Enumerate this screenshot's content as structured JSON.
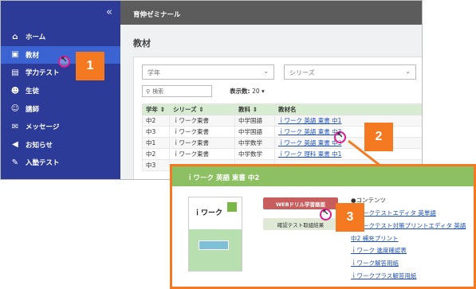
{
  "sidebar": {
    "collapse_glyph": "«",
    "items": [
      {
        "label": "ホーム",
        "icon": "home-icon",
        "glyph": "⌂",
        "active": false
      },
      {
        "label": "教材",
        "icon": "book-icon",
        "glyph": "▣",
        "active": true
      },
      {
        "label": "学力テスト",
        "icon": "test-icon",
        "glyph": "▤",
        "active": false
      },
      {
        "label": "生徒",
        "icon": "students-icon",
        "glyph": "☻",
        "active": false
      },
      {
        "label": "講師",
        "icon": "teachers-icon",
        "glyph": "☺",
        "active": false
      },
      {
        "label": "メッセージ",
        "icon": "message-icon",
        "glyph": "✉",
        "active": false
      },
      {
        "label": "お知らせ",
        "icon": "announce-icon",
        "glyph": "◀",
        "active": false
      },
      {
        "label": "入塾テスト",
        "icon": "entrance-test-icon",
        "glyph": "✎",
        "active": false
      }
    ]
  },
  "topbar": {
    "title": "育伸ゼミナール"
  },
  "main": {
    "title": "教材",
    "filters": {
      "grade_placeholder": "学年",
      "series_placeholder": "シリーズ"
    },
    "search_placeholder": "検索",
    "count_label": "表示数:",
    "count_value": "20 ▾",
    "table": {
      "headers": [
        "学年 ⇕",
        "シリーズ ⇕",
        "教科 ⇕",
        "教材名"
      ],
      "rows": [
        [
          "中2",
          "ｉワーク東書",
          "中学国語",
          "ｉワーク 英語 東書 中1"
        ],
        [
          "中3",
          "ｉワーク東書",
          "中学国語",
          "ｉワーク 英語 東書 中3"
        ],
        [
          "中1",
          "ｉワーク東書",
          "中学数学",
          "ｉワーク 英語 東書 中3"
        ],
        [
          "中2",
          "ｉワーク東書",
          "中学数学",
          "ｉワーク 理科 東書 中1"
        ],
        [
          "中3",
          "",
          "",
          ""
        ]
      ]
    }
  },
  "badges": [
    "1",
    "2",
    "3"
  ],
  "popup": {
    "title": "ｉワーク 英語 東書 中2",
    "book_title": "ｉワーク",
    "web_button": "WEBドリル学習画面",
    "manual_button": "確認テスト取組結果",
    "contents_heading": "●コンテンツ",
    "links": [
      "ｉワークテストエディタ 英単語",
      "ｉワークテスト対策プリントエディタ 英語",
      "中2 補充プリント",
      "ｉワーク 進度確認表",
      "ｉワーク解答用紙",
      "ｉワークプラス解答用紙"
    ]
  },
  "colors": {
    "sidebar": "#2c3a98",
    "active": "#3b63d1",
    "accent": "#f47920",
    "header_green": "#8cc063"
  }
}
